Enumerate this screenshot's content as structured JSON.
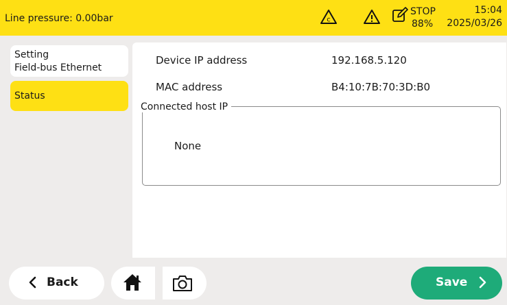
{
  "header": {
    "line_pressure": "Line pressure: 0.00bar",
    "stop_label": "STOP",
    "stop_percent": "88%",
    "time": "15:04",
    "date": "2025/03/26",
    "icons": [
      "calibration-warning-icon",
      "warning-icon",
      "edit-icon"
    ]
  },
  "sidebar": {
    "items": [
      {
        "label_line1": "Setting",
        "label_line2": "Field-bus Ethernet"
      },
      {
        "label_line1": "Status"
      }
    ]
  },
  "main": {
    "device_ip_label": "Device IP address",
    "device_ip_value": "192.168.5.120",
    "mac_label": "MAC address",
    "mac_value": "B4:10:7B:70:3D:B0",
    "connected_host_label": "Connected host IP",
    "connected_host_value": "None"
  },
  "footer": {
    "back_label": "Back",
    "save_label": "Save",
    "icons": [
      "home-icon",
      "camera-icon"
    ]
  },
  "colors": {
    "header_bg": "#fee014",
    "active_tab": "#fee014",
    "save_button": "#1eab79",
    "background": "#eeeceb"
  }
}
